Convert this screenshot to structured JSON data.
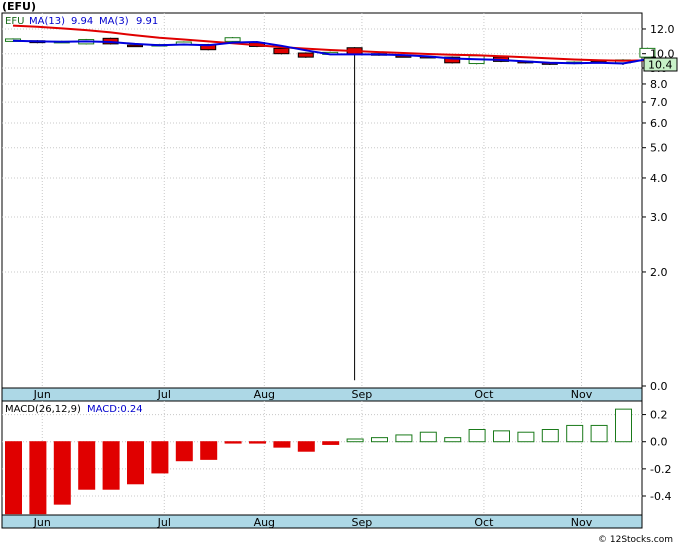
{
  "header": {
    "ticker": "(EFU)",
    "symbol": "EFU",
    "ma13_label": "MA(13)",
    "ma13_value": "9.94",
    "ma3_label": "MA(3)",
    "ma3_value": "9.91"
  },
  "macd_legend": {
    "params": "MACD(26,12,9)",
    "value_label": "MACD:0.24"
  },
  "last_price": "10.4",
  "footer": "© 12Stocks.com",
  "colors": {
    "up": "#1a7a1a",
    "down": "#e00000",
    "ma13": "#e00000",
    "ma3": "#0000dd",
    "axis_band": "#add8e6",
    "grid": "#c8c8c8",
    "price_box": "#c8f0c8"
  },
  "chart_data": [
    {
      "type": "candlestick",
      "scale": "log",
      "ylim": [
        0.85,
        13.5
      ],
      "y_ticks": [
        0.0,
        2.0,
        3.0,
        4.0,
        5.0,
        6.0,
        7.0,
        8.0,
        9.0,
        10.0,
        12.0
      ],
      "x_ticks": [
        "Jun",
        "Jul",
        "Aug",
        "Sep",
        "Oct",
        "Nov"
      ],
      "x_tick_positions": [
        1.2,
        6.2,
        10.3,
        14.3,
        19.3,
        23.3
      ],
      "grid": true,
      "candles": [
        {
          "open": 10.95,
          "close": 11.15,
          "high": 11.2,
          "low": 10.9
        },
        {
          "open": 11.0,
          "close": 10.85,
          "high": 11.05,
          "low": 10.8
        },
        {
          "open": 10.9,
          "close": 10.95,
          "high": 11.0,
          "low": 10.85
        },
        {
          "open": 10.75,
          "close": 11.1,
          "high": 11.15,
          "low": 10.7
        },
        {
          "open": 11.2,
          "close": 10.75,
          "high": 11.25,
          "low": 10.7
        },
        {
          "open": 10.65,
          "close": 10.6,
          "high": 10.7,
          "low": 10.55
        },
        {
          "open": 10.6,
          "close": 10.7,
          "high": 10.75,
          "low": 10.55
        },
        {
          "open": 10.7,
          "close": 10.9,
          "high": 10.95,
          "low": 10.65
        },
        {
          "open": 10.7,
          "close": 10.3,
          "high": 10.75,
          "low": 10.25
        },
        {
          "open": 10.95,
          "close": 11.25,
          "high": 11.3,
          "low": 10.9
        },
        {
          "open": 10.85,
          "close": 10.55,
          "high": 10.9,
          "low": 10.5
        },
        {
          "open": 10.4,
          "close": 10.0,
          "high": 10.45,
          "low": 9.95
        },
        {
          "open": 10.05,
          "close": 9.75,
          "high": 10.1,
          "low": 9.7
        },
        {
          "open": 9.95,
          "close": 10.1,
          "high": 10.15,
          "low": 9.9
        },
        {
          "open": 10.45,
          "close": 9.95,
          "high": 10.5,
          "low": 0.9
        },
        {
          "open": 10.0,
          "close": 9.9,
          "high": 10.05,
          "low": 9.85
        },
        {
          "open": 9.85,
          "close": 9.8,
          "high": 9.9,
          "low": 9.75
        },
        {
          "open": 9.8,
          "close": 9.75,
          "high": 9.85,
          "low": 9.7
        },
        {
          "open": 9.75,
          "close": 9.35,
          "high": 9.8,
          "low": 9.3
        },
        {
          "open": 9.3,
          "close": 9.85,
          "high": 9.9,
          "low": 9.25
        },
        {
          "open": 9.75,
          "close": 9.45,
          "high": 9.8,
          "low": 9.4
        },
        {
          "open": 9.45,
          "close": 9.35,
          "high": 9.5,
          "low": 9.3
        },
        {
          "open": 9.35,
          "close": 9.25,
          "high": 9.4,
          "low": 9.2
        },
        {
          "open": 9.3,
          "close": 9.4,
          "high": 9.45,
          "low": 9.25
        },
        {
          "open": 9.45,
          "close": 9.4,
          "high": 9.5,
          "low": 9.35
        },
        {
          "open": 9.35,
          "close": 9.55,
          "high": 9.6,
          "low": 9.2
        },
        {
          "open": 9.75,
          "close": 10.4,
          "high": 10.45,
          "low": 9.7
        }
      ],
      "ma13": [
        12.3,
        12.2,
        12.05,
        11.9,
        11.7,
        11.45,
        11.25,
        11.1,
        10.95,
        10.8,
        10.65,
        10.5,
        10.38,
        10.28,
        10.2,
        10.12,
        10.05,
        9.98,
        9.92,
        9.88,
        9.82,
        9.74,
        9.66,
        9.58,
        9.53,
        9.5,
        9.52
      ],
      "ma3": [
        11.0,
        10.95,
        10.92,
        10.95,
        10.9,
        10.75,
        10.65,
        10.7,
        10.65,
        10.85,
        10.9,
        10.6,
        10.25,
        9.95,
        9.95,
        9.95,
        9.9,
        9.8,
        9.65,
        9.6,
        9.55,
        9.45,
        9.35,
        9.32,
        9.35,
        9.3,
        9.6
      ]
    },
    {
      "type": "bar",
      "name": "MACD",
      "ylim": [
        -0.54,
        0.3
      ],
      "y_ticks": [
        0.2,
        0.0,
        -0.2,
        -0.4
      ],
      "x_ticks": [
        "Jun",
        "Jul",
        "Aug",
        "Sep",
        "Oct",
        "Nov"
      ],
      "values": [
        -0.53,
        -0.53,
        -0.46,
        -0.35,
        -0.35,
        -0.31,
        -0.23,
        -0.14,
        -0.13,
        -0.01,
        -0.01,
        -0.04,
        -0.07,
        -0.02,
        0.02,
        0.03,
        0.05,
        0.07,
        0.03,
        0.09,
        0.08,
        0.07,
        0.09,
        0.12,
        0.12,
        0.24
      ]
    }
  ]
}
